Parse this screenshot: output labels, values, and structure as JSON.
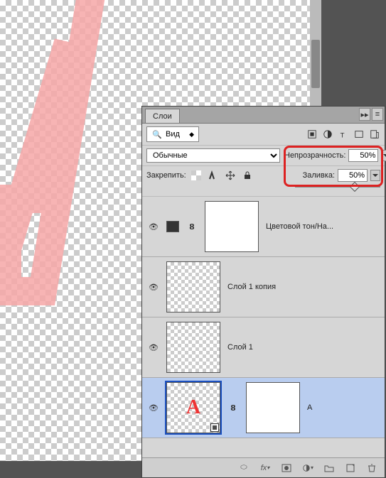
{
  "panel": {
    "title": "Слои"
  },
  "search": {
    "label": "Вид"
  },
  "blend": {
    "mode": "Обычные"
  },
  "opacity": {
    "label": "Непрозрачность:",
    "value": "50%"
  },
  "fill": {
    "label": "Заливка:",
    "value": "50%"
  },
  "lock": {
    "label": "Закрепить:"
  },
  "layers": [
    {
      "name": "Цветовой тон/На...",
      "kind": "adjustment"
    },
    {
      "name": "Слой 1 копия",
      "kind": "raster"
    },
    {
      "name": "Слой 1",
      "kind": "raster"
    },
    {
      "name": "A",
      "kind": "text",
      "selected": true
    }
  ],
  "glyph": {
    "A": "A",
    "eye": "👁"
  }
}
